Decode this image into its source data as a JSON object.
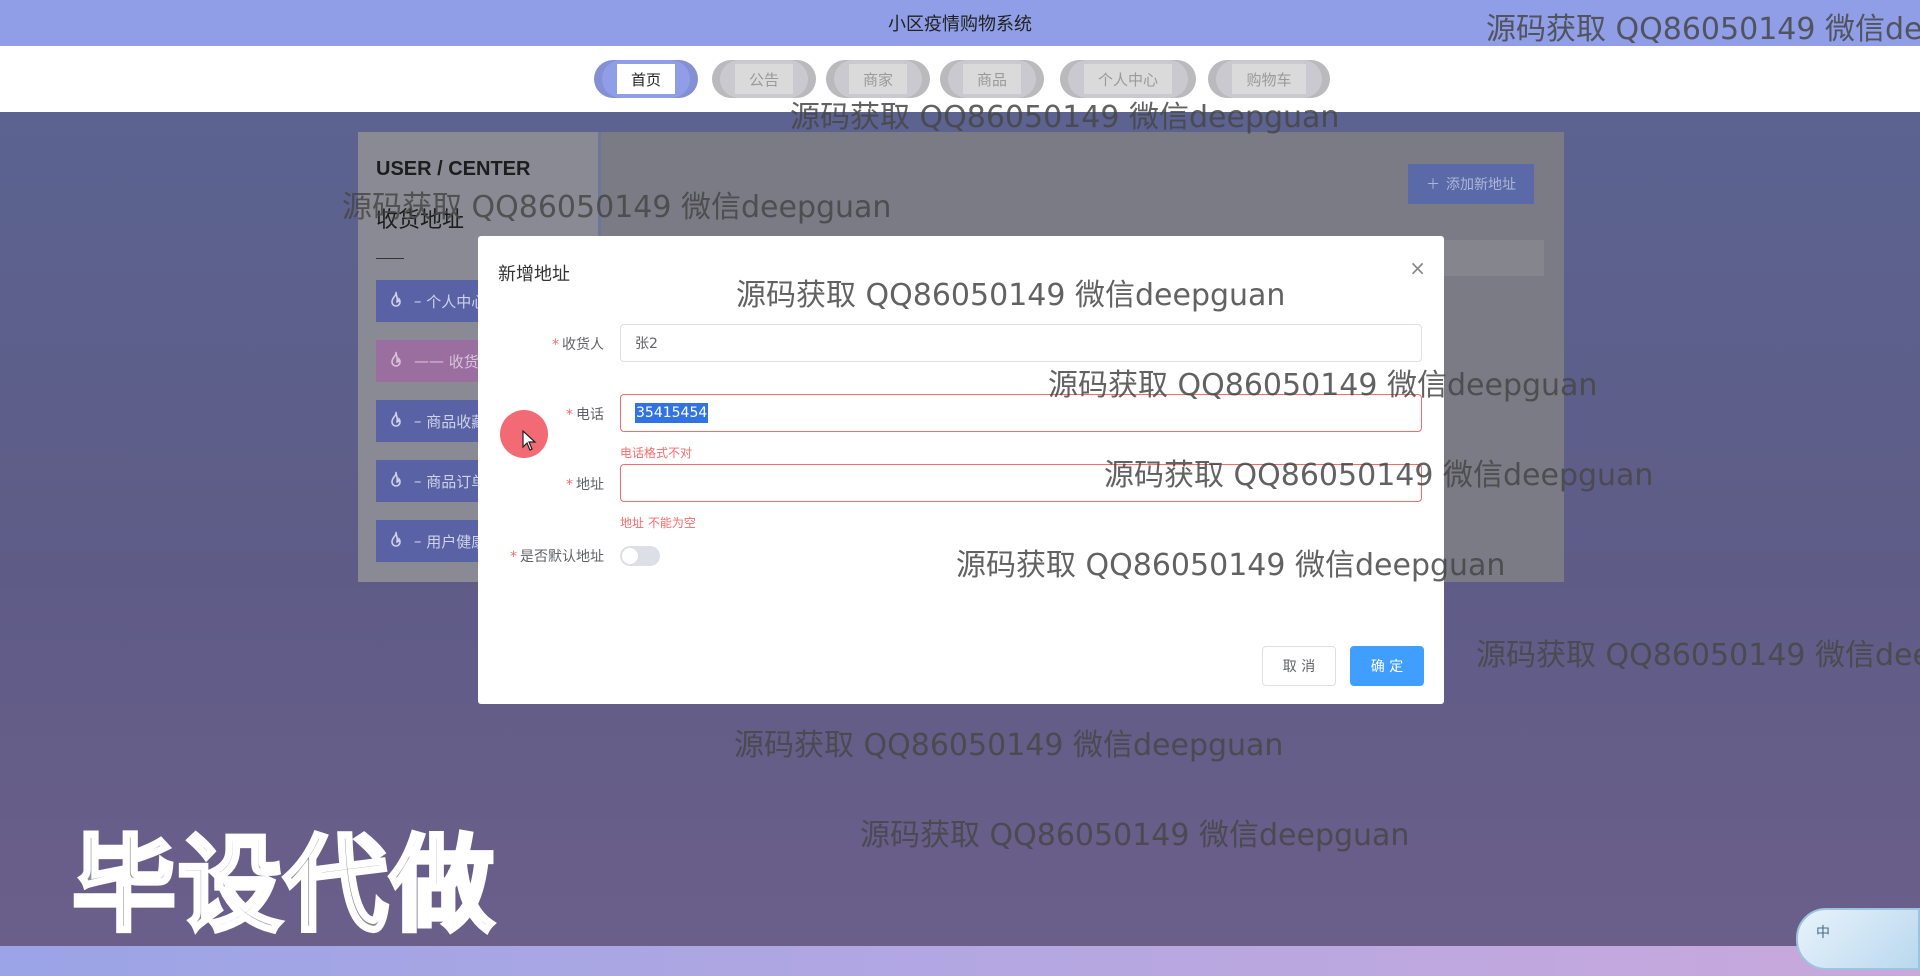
{
  "app": {
    "title": "小区疫情购物系统"
  },
  "nav": {
    "items": [
      {
        "label": "首页",
        "active": true
      },
      {
        "label": "公告"
      },
      {
        "label": "商家"
      },
      {
        "label": "商品"
      },
      {
        "label": "个人中心"
      },
      {
        "label": "购物车"
      }
    ]
  },
  "panel": {
    "title": "USER / CENTER",
    "subtitle": "收货地址",
    "add_button": "添加新地址",
    "sidebar": [
      {
        "label": "个人中心",
        "prefix": "–"
      },
      {
        "label": "收货地址",
        "prefix": "——",
        "active": true
      },
      {
        "label": "商品收藏",
        "prefix": "–"
      },
      {
        "label": "商品订单",
        "prefix": "–"
      },
      {
        "label": "用户健康",
        "prefix": "–"
      }
    ]
  },
  "modal": {
    "title": "新增地址",
    "close": "×",
    "fields": {
      "receiver": {
        "label": "收货人",
        "value": "张2"
      },
      "phone": {
        "label": "电话",
        "value": "35415454",
        "error": "电话格式不对"
      },
      "address": {
        "label": "地址",
        "value": "",
        "error": "地址 不能为空"
      },
      "default": {
        "label": "是否默认地址",
        "on": false
      }
    },
    "cancel": "取 消",
    "confirm": "确 定"
  },
  "watermark": {
    "text": "源码获取 QQ86050149 微信deepguan"
  },
  "promo": "毕设代做",
  "ime": {
    "label": "中"
  },
  "colors": {
    "topbar": "#8f9ee6",
    "primary": "#409eff",
    "error": "#f56c6c"
  }
}
